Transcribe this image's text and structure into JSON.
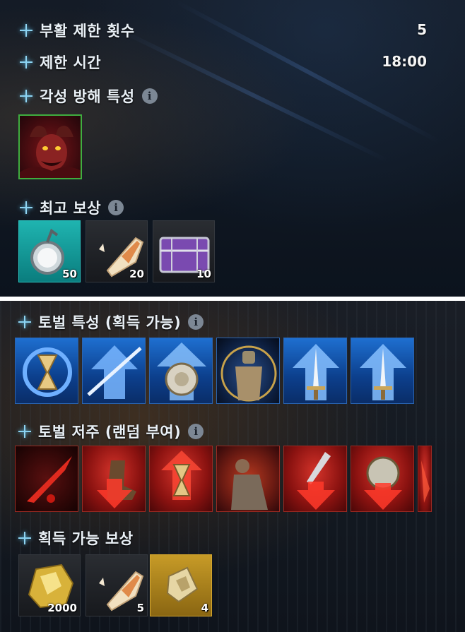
{
  "raid_info": {
    "revive_limit": {
      "label": "부활 제한 횟수",
      "value": "5"
    },
    "time_limit": {
      "label": "제한 시간",
      "value": "18:00"
    },
    "awakening_trait": {
      "label": "각성 방해 특성",
      "info_icon": "i"
    },
    "best_reward": {
      "label": "최고 보상",
      "info_icon": "i",
      "items": [
        {
          "icon": "orb-pendant-icon",
          "count": "50"
        },
        {
          "icon": "parchment-scroll-icon",
          "count": "20"
        },
        {
          "icon": "purple-chest-icon",
          "count": "10"
        }
      ]
    }
  },
  "torbel": {
    "traits": {
      "label": "토벌 특성 (획득 가능)",
      "info_icon": "i",
      "icons": [
        "hourglass-cycle-icon",
        "arrow-slash-icon",
        "shield-up-icon",
        "knight-aura-icon",
        "sword-up-icon",
        "sword-up-icon-2"
      ]
    },
    "curses": {
      "label": "토벌 저주 (랜덤 부여)",
      "info_icon": "i",
      "icons": [
        "bleed-slash-icon",
        "boot-down-icon",
        "hourglass-curse-icon",
        "wounded-knight-icon",
        "dagger-down-icon",
        "shield-down-icon",
        "partial-curse-icon"
      ]
    },
    "rewards": {
      "label": "획득 가능 보상",
      "items": [
        {
          "icon": "gold-ore-icon",
          "count": "2000"
        },
        {
          "icon": "parchment-scroll-icon",
          "count": "5"
        },
        {
          "icon": "gold-fragment-icon",
          "count": "4"
        }
      ]
    }
  },
  "colors": {
    "accent_star": "#8fd4f2",
    "trait_blue": "#1e6fd0",
    "curse_red": "#d4332a"
  }
}
